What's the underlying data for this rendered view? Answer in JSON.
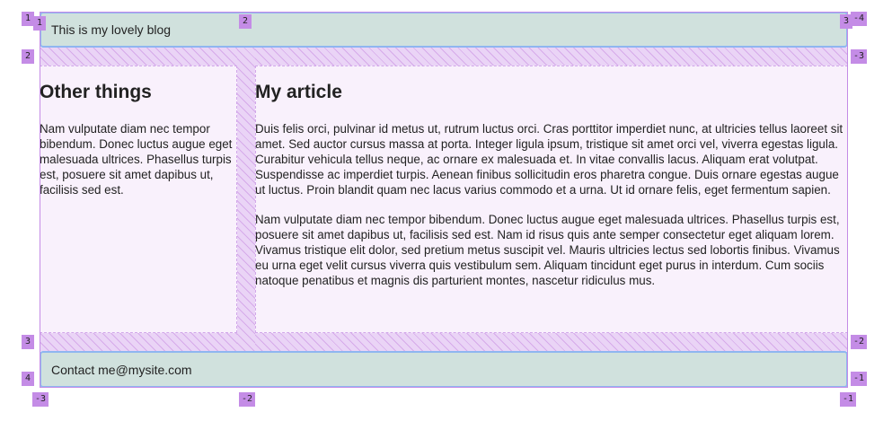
{
  "header": {
    "text": "This is my lovely blog"
  },
  "sidebar": {
    "title": "Other things",
    "paragraph": "Nam vulputate diam nec tempor bibendum. Donec luctus augue eget malesuada ultrices. Phasellus turpis est, posuere sit amet dapibus ut, facilisis sed est."
  },
  "article": {
    "title": "My article",
    "paragraphs": [
      "Duis felis orci, pulvinar id metus ut, rutrum luctus orci. Cras porttitor imperdiet nunc, at ultricies tellus laoreet sit amet. Sed auctor cursus massa at porta. Integer ligula ipsum, tristique sit amet orci vel, viverra egestas ligula. Curabitur vehicula tellus neque, ac ornare ex malesuada et. In vitae convallis lacus. Aliquam erat volutpat. Suspendisse ac imperdiet turpis. Aenean finibus sollicitudin eros pharetra congue. Duis ornare egestas augue ut luctus. Proin blandit quam nec lacus varius commodo et a urna. Ut id ornare felis, eget fermentum sapien.",
      "Nam vulputate diam nec tempor bibendum. Donec luctus augue eget malesuada ultrices. Phasellus turpis est, posuere sit amet dapibus ut, facilisis sed est. Nam id risus quis ante semper consectetur eget aliquam lorem. Vivamus tristique elit dolor, sed pretium metus suscipit vel. Mauris ultricies lectus sed lobortis finibus. Vivamus eu urna eget velit cursus viverra quis vestibulum sem. Aliquam tincidunt eget purus in interdum. Cum sociis natoque penatibus et magnis dis parturient montes, nascetur ridiculus mus."
    ]
  },
  "footer": {
    "text": "Contact me@mysite.com"
  },
  "grid_overlay": {
    "color": "#c48ce6",
    "row_labels_left": [
      "1",
      "2",
      "3",
      "4"
    ],
    "row_labels_right": [
      "-4",
      "-3",
      "-2",
      "-1"
    ],
    "col_labels_top": [
      "1",
      "2",
      "3"
    ],
    "col_labels_bottom": [
      "-3",
      "-2",
      "-1"
    ]
  }
}
